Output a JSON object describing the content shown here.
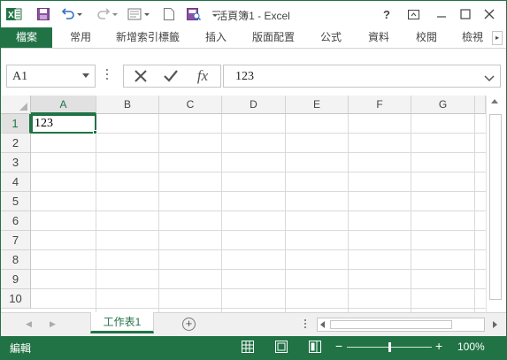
{
  "title_bar": {
    "title": "活頁簿1 - Excel",
    "help_label": "?",
    "qat_icons": [
      "excel-logo-icon",
      "save-icon",
      "undo-icon",
      "redo-icon",
      "form-icon",
      "new-document-icon",
      "print-preview-icon",
      "customize-qat-icon"
    ],
    "window_buttons": [
      "help-icon",
      "ribbon-display-options-icon",
      "minimize-icon",
      "restore-icon",
      "close-icon"
    ]
  },
  "ribbon": {
    "tabs": [
      {
        "label": "檔案"
      },
      {
        "label": "常用"
      },
      {
        "label": "新增索引標籤"
      },
      {
        "label": "插入"
      },
      {
        "label": "版面配置"
      },
      {
        "label": "公式"
      },
      {
        "label": "資料"
      },
      {
        "label": "校閱"
      },
      {
        "label": "檢視"
      }
    ]
  },
  "formula_bar": {
    "name_box_value": "A1",
    "formula_value": "123",
    "fx_label": "fx"
  },
  "grid": {
    "columns": [
      "A",
      "B",
      "C",
      "D",
      "E",
      "F",
      "G"
    ],
    "rows": [
      "1",
      "2",
      "3",
      "4",
      "5",
      "6",
      "7",
      "8",
      "9",
      "10"
    ],
    "active_column": "A",
    "active_row": "1",
    "cell_a1_value": "123"
  },
  "sheet_bar": {
    "sheet_tab_label": "工作表1",
    "add_sheet_label": "+"
  },
  "status_bar": {
    "mode": "編輯",
    "zoom_level": "100%"
  },
  "colors": {
    "accent": "#217346",
    "header_bg": "#f3f3f3",
    "grid_line": "#dadada"
  }
}
